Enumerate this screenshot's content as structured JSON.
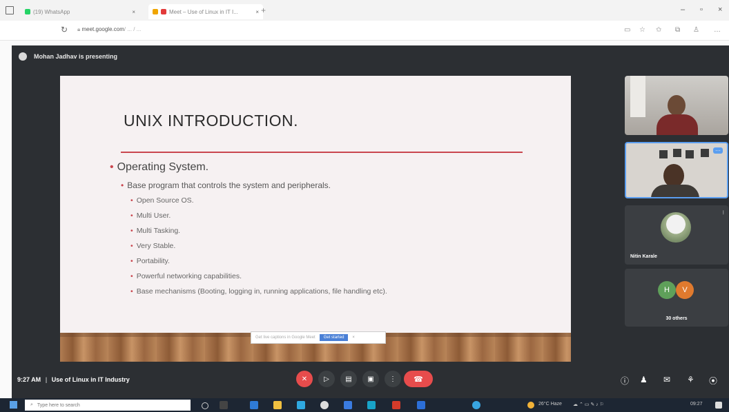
{
  "browser": {
    "tabs": [
      {
        "label": "(19) WhatsApp"
      },
      {
        "label": "Meet – Use of Linux in IT I..."
      }
    ],
    "url_host": "meet.google.com",
    "url_path": "/ ... / ...",
    "window_controls": {
      "minimize": "–",
      "maximize": "▫",
      "close": "×"
    }
  },
  "meet": {
    "presenting_text": "Mohan Jadhav is presenting",
    "time": "9:27 AM",
    "meeting_title": "Use of Linux in IT Industry",
    "separator": "|",
    "tiles": [
      {
        "name": ""
      },
      {
        "name": ""
      },
      {
        "name": "Nitin Karale"
      },
      {
        "name": "30 others",
        "avatars": [
          "H",
          "V"
        ]
      }
    ],
    "caption_bar": {
      "text": "Get live captions in Google Meet",
      "button": "Get started"
    }
  },
  "slide": {
    "title": "UNIX INTRODUCTION.",
    "level1": "Operating System.",
    "level2": "Base program that controls the system and peripherals.",
    "level3": [
      "Open Source OS.",
      "Multi User.",
      "Multi Tasking.",
      "Very Stable.",
      "Portability.",
      "Powerful networking capabilities.",
      "Base mechanisms (Booting, logging in, running applications, file handling etc)."
    ]
  },
  "taskbar": {
    "search_placeholder": "Type here to search",
    "tray_weather": "26°C Haze",
    "tray_time": "09:27"
  },
  "colors": {
    "accent_red": "#e74c4c",
    "slide_rule": "#c9464e",
    "meet_bg": "#2c2f33",
    "active_tile_border": "#5b9ef0"
  }
}
